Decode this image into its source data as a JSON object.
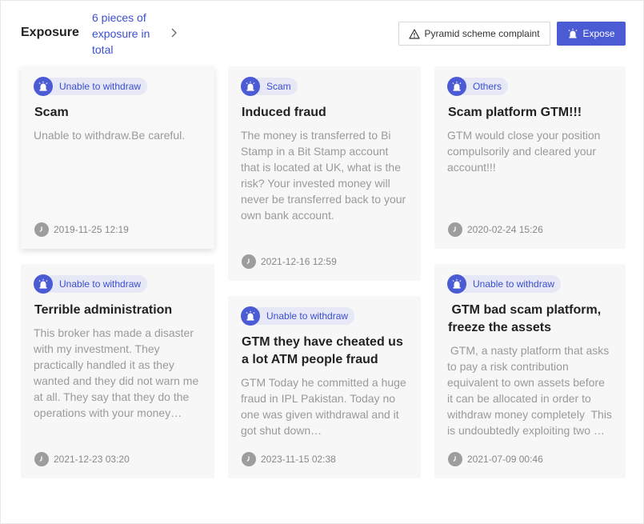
{
  "header": {
    "title": "Exposure",
    "count_text": "6 pieces of exposure in total",
    "pyramid_button_label": "Pyramid scheme complaint",
    "expose_button_label": "Expose"
  },
  "colors": {
    "accent": "#4a5bd4",
    "tag_bg": "#e6e8f6",
    "card_bg": "#f7f7f8"
  },
  "cards": [
    {
      "tag": "Unable to withdraw",
      "title": "Scam",
      "body": "Unable to withdraw.Be careful.",
      "time": "2019-11-25 12:19"
    },
    {
      "tag": "Scam",
      "title": "Induced fraud",
      "body": "The money is transferred to Bi Stamp in a Bit Stamp account that is located at UK, what is the risk? Your invested money will never be transferred back to your own bank account.",
      "time": "2021-12-16 12:59"
    },
    {
      "tag": "Others",
      "title": "Scam platform GTM!!!",
      "body": "GTM would close your position compulsorily and cleared your account!!!",
      "time": "2020-02-24 15:26"
    },
    {
      "tag": "Unable to withdraw",
      "title": "Terrible administration",
      "body": "This broker has made a disaster with my investment. They practically handled it as they wanted and they did not warn me at all. They say that they do the operations with your money…",
      "time": "2021-12-23 03:20"
    },
    {
      "tag": "Unable to withdraw",
      "title": "GTM they have cheated us a lot ATM people fraud",
      "body": "GTM Today he committed a huge fraud in IPL Pakistan. Today no one was given withdrawal and it got shut down…",
      "time": "2023-11-15 02:38"
    },
    {
      "tag": "Unable to withdraw",
      "title": " GTM bad scam platform, freeze the assets",
      "body": " GTM, a nasty platform that asks to pay a risk contribution equivalent to own assets before it can be allocated in order to withdraw money completely  This is undoubtedly exploiting two …",
      "time": "2021-07-09 00:46"
    }
  ]
}
